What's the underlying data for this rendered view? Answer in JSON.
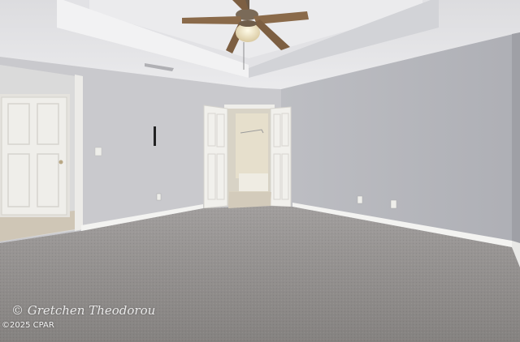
{
  "photo": {
    "watermark_signature": "© Gretchen Theodorou",
    "copyright_line": "©2025 CPAR"
  },
  "colors": {
    "wall": "#c9c9cd",
    "wall_right": "#b5b6bb",
    "ceiling": "#e6e6e8",
    "carpet": "#8f8c8b",
    "trim": "#f4f4f2",
    "door": "#efeeea",
    "fan_blade": "#8a6a4a"
  }
}
